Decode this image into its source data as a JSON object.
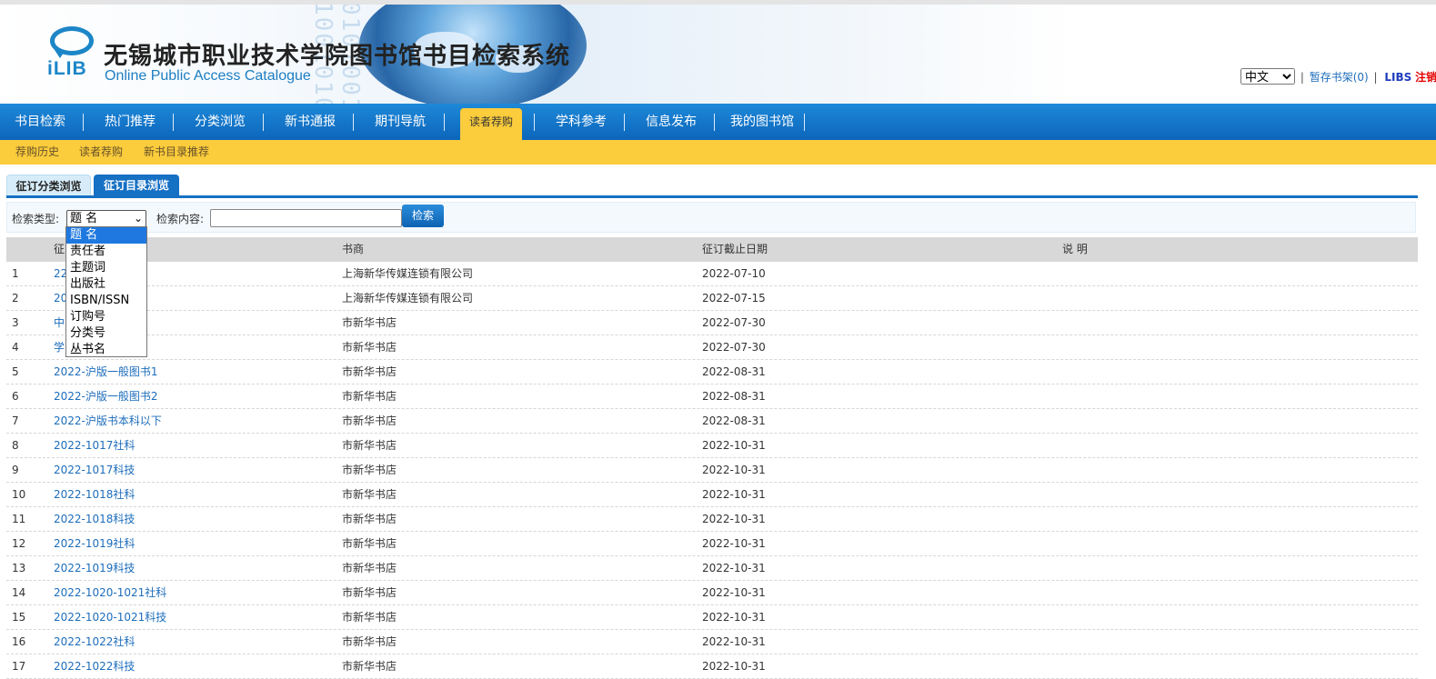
{
  "header": {
    "logo_text": "iLIB",
    "title": "无锡城市职业技术学院图书馆书目检索系统",
    "subtitle": "Online Public Access Catalogue",
    "language": "中文",
    "shelf_link": "暂存书架(0)",
    "libs_link": "LIBS",
    "logout_link": "注销"
  },
  "nav": {
    "items": [
      "书目检索",
      "热门推荐",
      "分类浏览",
      "新书通报",
      "期刊导航",
      "读者荐购",
      "学科参考",
      "信息发布",
      "我的图书馆"
    ],
    "active": "读者荐购"
  },
  "subnav": {
    "items": [
      "荐购历史",
      "读者荐购",
      "新书目录推荐"
    ]
  },
  "tabs": {
    "items": [
      "征订分类浏览",
      "征订目录浏览"
    ],
    "active": "征订目录浏览"
  },
  "search": {
    "type_label": "检索类型:",
    "type_value": "题  名",
    "content_label": "检索内容:",
    "content_value": "",
    "button_label": "检索",
    "type_options": [
      "题  名",
      "责任者",
      "主题词",
      "出版社",
      "ISBN/ISSN",
      "订购号",
      "分类号",
      "丛书名"
    ]
  },
  "table": {
    "headers": [
      "",
      "征",
      "书商",
      "征订截止日期",
      "说 明"
    ],
    "rows": [
      {
        "no": "1",
        "name": "22",
        "vendor": "上海新华传媒连锁有限公司",
        "deadline": "2022-07-10",
        "note": ""
      },
      {
        "no": "2",
        "name": "20",
        "vendor": "上海新华传媒连锁有限公司",
        "deadline": "2022-07-15",
        "note": ""
      },
      {
        "no": "3",
        "name": "中",
        "vendor": "市新华书店",
        "deadline": "2022-07-30",
        "note": ""
      },
      {
        "no": "4",
        "name": "学",
        "vendor": "市新华书店",
        "deadline": "2022-07-30",
        "note": ""
      },
      {
        "no": "5",
        "name": "2022-沪版一般图书1",
        "vendor": "市新华书店",
        "deadline": "2022-08-31",
        "note": ""
      },
      {
        "no": "6",
        "name": "2022-沪版一般图书2",
        "vendor": "市新华书店",
        "deadline": "2022-08-31",
        "note": ""
      },
      {
        "no": "7",
        "name": "2022-沪版书本科以下",
        "vendor": "市新华书店",
        "deadline": "2022-08-31",
        "note": ""
      },
      {
        "no": "8",
        "name": "2022-1017社科",
        "vendor": "市新华书店",
        "deadline": "2022-10-31",
        "note": ""
      },
      {
        "no": "9",
        "name": "2022-1017科技",
        "vendor": "市新华书店",
        "deadline": "2022-10-31",
        "note": ""
      },
      {
        "no": "10",
        "name": "2022-1018社科",
        "vendor": "市新华书店",
        "deadline": "2022-10-31",
        "note": ""
      },
      {
        "no": "11",
        "name": "2022-1018科技",
        "vendor": "市新华书店",
        "deadline": "2022-10-31",
        "note": ""
      },
      {
        "no": "12",
        "name": "2022-1019社科",
        "vendor": "市新华书店",
        "deadline": "2022-10-31",
        "note": ""
      },
      {
        "no": "13",
        "name": "2022-1019科技",
        "vendor": "市新华书店",
        "deadline": "2022-10-31",
        "note": ""
      },
      {
        "no": "14",
        "name": "2022-1020-1021社科",
        "vendor": "市新华书店",
        "deadline": "2022-10-31",
        "note": ""
      },
      {
        "no": "15",
        "name": "2022-1020-1021科技",
        "vendor": "市新华书店",
        "deadline": "2022-10-31",
        "note": ""
      },
      {
        "no": "16",
        "name": "2022-1022社科",
        "vendor": "市新华书店",
        "deadline": "2022-10-31",
        "note": ""
      },
      {
        "no": "17",
        "name": "2022-1022科技",
        "vendor": "市新华书店",
        "deadline": "2022-10-31",
        "note": ""
      }
    ]
  },
  "colors": {
    "nav_blue": "#0c66bb",
    "accent_yellow": "#fbcc3b",
    "link_blue": "#1d6dbb",
    "logout_red": "#e30000"
  }
}
